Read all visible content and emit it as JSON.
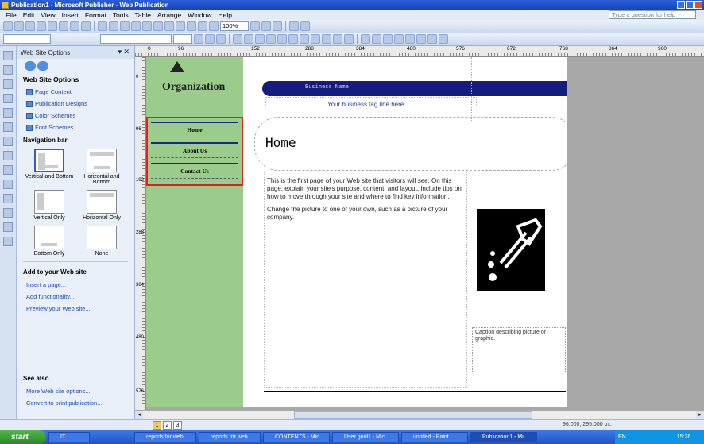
{
  "window": {
    "title": "Publication1 - Microsoft Publisher - Web Publication"
  },
  "menu": {
    "items": [
      "File",
      "Edit",
      "View",
      "Insert",
      "Format",
      "Tools",
      "Table",
      "Arrange",
      "Window",
      "Help"
    ],
    "help_placeholder": "Type a question for help"
  },
  "toolbar": {
    "zoom": "100%"
  },
  "taskpane": {
    "header": "Web Site Options",
    "title": "Web Site Options",
    "links": [
      "Page Content",
      "Publication Designs",
      "Color Schemes",
      "Font Schemes"
    ],
    "navbar_title": "Navigation bar",
    "navbar_options": [
      {
        "label": "Vertical and Bottom",
        "selected": true
      },
      {
        "label": "Horizontal and Bottom",
        "selected": false
      },
      {
        "label": "Vertical Only",
        "selected": false
      },
      {
        "label": "Horizontal Only",
        "selected": false
      },
      {
        "label": "Bottom Only",
        "selected": false
      },
      {
        "label": "None",
        "selected": false
      }
    ],
    "add_title": "Add to your Web site",
    "add_links": [
      "Insert a page...",
      "Add functionality...",
      "Preview your Web site..."
    ],
    "seealso_title": "See also",
    "seealso_links": [
      "More Web site options...",
      "Convert to print publication..."
    ]
  },
  "ruler": {
    "h_ticks": [
      "0",
      "96",
      "152",
      "288",
      "384",
      "480",
      "576",
      "672",
      "768",
      "864",
      "960"
    ],
    "v_ticks": [
      "0",
      "96",
      "192",
      "288",
      "384",
      "480",
      "576"
    ]
  },
  "page": {
    "organization": "Organization",
    "business_name": "Business Name",
    "tagline": "Your business tag line here.",
    "nav_buttons": [
      "Home",
      "About Us",
      "Contact Us"
    ],
    "home_title": "Home",
    "body_p1": "This is the first page of your Web site that visitors will see. On this page, explain your site's purpose, content, and layout. Include tips on how to move through your site and where to find key information.",
    "body_p2": "Change the picture to one of your own, such as a picture of your company.",
    "caption": "Caption describing picture or graphic.",
    "header_color": "#141c7e",
    "nav_color": "#9ccc8c"
  },
  "status": {
    "pages": [
      "1",
      "2",
      "3"
    ],
    "coords": "96.000, 295.000 px."
  },
  "taskbar": {
    "start": "start",
    "buttons": [
      "IT",
      "reports for web...",
      "reports for web...",
      "CONTENTS - Mic...",
      "User guid1 - Mic...",
      "untitled - Paint",
      "Publication1 - Mi..."
    ],
    "tray_lang": "EN",
    "tray_time": "15:26"
  }
}
